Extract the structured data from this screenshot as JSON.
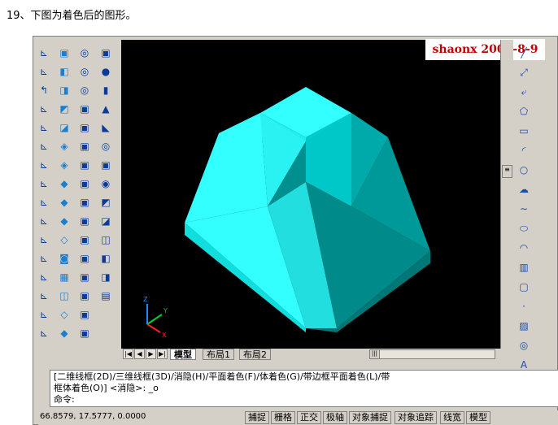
{
  "caption": "19、下图为着色后的图形。",
  "watermark": "shaonx 2009-8-9",
  "tabs": {
    "model": "模型",
    "layout1": "布局1",
    "layout2": "布局2"
  },
  "command": {
    "line1": "[二维线框(2D)/三维线框(3D)/消隐(H)/平面着色(F)/体着色(G)/带边框平面着色(L)/带",
    "line2": "框体着色(O)] <消隐>: _o",
    "line3": "命令:"
  },
  "status": {
    "coords": "66.8579, 17.5777, 0.0000",
    "buttons": [
      "捕捉",
      "栅格",
      "正交",
      "极轴",
      "对象捕捉",
      "对象追踪",
      "线宽",
      "模型"
    ]
  },
  "ucs": {
    "x": "X",
    "y": "Y",
    "z": "Z"
  },
  "colors": {
    "shape_light": "#33ffff",
    "shape_mid": "#00dddd",
    "shape_dark": "#00a8a8",
    "shape_darker": "#008888",
    "background": "#000000"
  }
}
